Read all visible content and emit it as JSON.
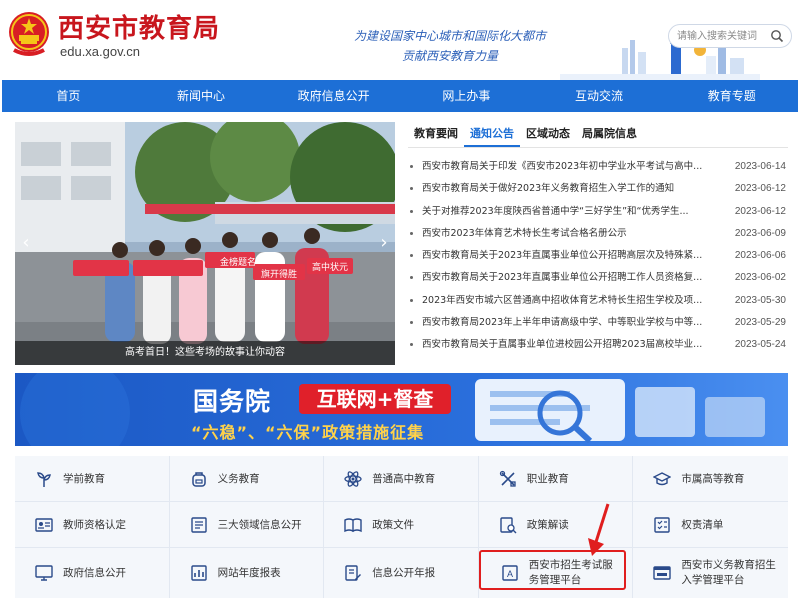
{
  "header": {
    "title": "西安市教育局",
    "domain": "edu.xa.gov.cn",
    "slogan_line1": "为建设国家中心城市和国际化大都市",
    "slogan_line2": "贡献西安教育力量",
    "search_placeholder": "请输入搜索关键词"
  },
  "nav": [
    "首页",
    "新闻中心",
    "政府信息公开",
    "网上办事",
    "互动交流",
    "教育专题"
  ],
  "carousel": {
    "caption": "高考首日！这些考场的故事让你动容",
    "photo_signs": [
      "旗开得胜",
      "金榜题名",
      "高中状元"
    ]
  },
  "news": {
    "tabs": [
      "教育要闻",
      "通知公告",
      "区域动态",
      "局属院信息"
    ],
    "active_tab": 1,
    "items": [
      {
        "title": "西安市教育局关于印发《西安市2023年初中学业水平考试与高中...",
        "date": "2023-06-14"
      },
      {
        "title": "西安市教育局关于做好2023年义务教育招生入学工作的通知",
        "date": "2023-06-12"
      },
      {
        "title": "关于对推荐2023年度陕西省普通中学“三好学生”和“优秀学生...",
        "date": "2023-06-12"
      },
      {
        "title": "西安市2023年体育艺术特长生考试合格名册公示",
        "date": "2023-06-09"
      },
      {
        "title": "西安市教育局关于2023年直属事业单位公开招聘高层次及特殊紧...",
        "date": "2023-06-06"
      },
      {
        "title": "西安市教育局关于2023年直属事业单位公开招聘工作人员资格复...",
        "date": "2023-06-02"
      },
      {
        "title": "2023年西安市城六区普通高中招收体育艺术特长生招生学校及项...",
        "date": "2023-05-30"
      },
      {
        "title": "西安市教育局2023年上半年申请高级中学、中等职业学校与中等...",
        "date": "2023-05-29"
      },
      {
        "title": "西安市教育局关于直属事业单位进校园公开招聘2023届高校毕业...",
        "date": "2023-05-24"
      }
    ]
  },
  "banner": {
    "title1": "国务院",
    "title2": "互联网+督查",
    "subtitle": "“六稳”、“六保”政策措施征集"
  },
  "services": [
    {
      "label": "学前教育",
      "icon": "sprout-icon"
    },
    {
      "label": "义务教育",
      "icon": "backpack-icon"
    },
    {
      "label": "普通高中教育",
      "icon": "atom-icon"
    },
    {
      "label": "职业教育",
      "icon": "tools-icon"
    },
    {
      "label": "市属高等教育",
      "icon": "graduation-cap-icon"
    },
    {
      "label": "教师资格认定",
      "icon": "id-card-icon"
    },
    {
      "label": "三大领域信息公开",
      "icon": "list-icon"
    },
    {
      "label": "政策文件",
      "icon": "open-book-icon"
    },
    {
      "label": "政策解读",
      "icon": "document-magnifier-icon"
    },
    {
      "label": "权责清单",
      "icon": "checklist-icon"
    },
    {
      "label": "政府信息公开",
      "icon": "monitor-icon"
    },
    {
      "label": "网站年度报表",
      "icon": "report-icon"
    },
    {
      "label": "信息公开年报",
      "icon": "document-pen-icon"
    },
    {
      "label": "西安市招生考试服务管理平台",
      "icon": "exam-icon"
    },
    {
      "label": "西安市义务教育招生入学管理平台",
      "icon": "browser-window-icon"
    }
  ],
  "colors": {
    "brand_red": "#c8161d",
    "nav_blue": "#1d6fd6",
    "highlight_red": "#e01e1e"
  }
}
